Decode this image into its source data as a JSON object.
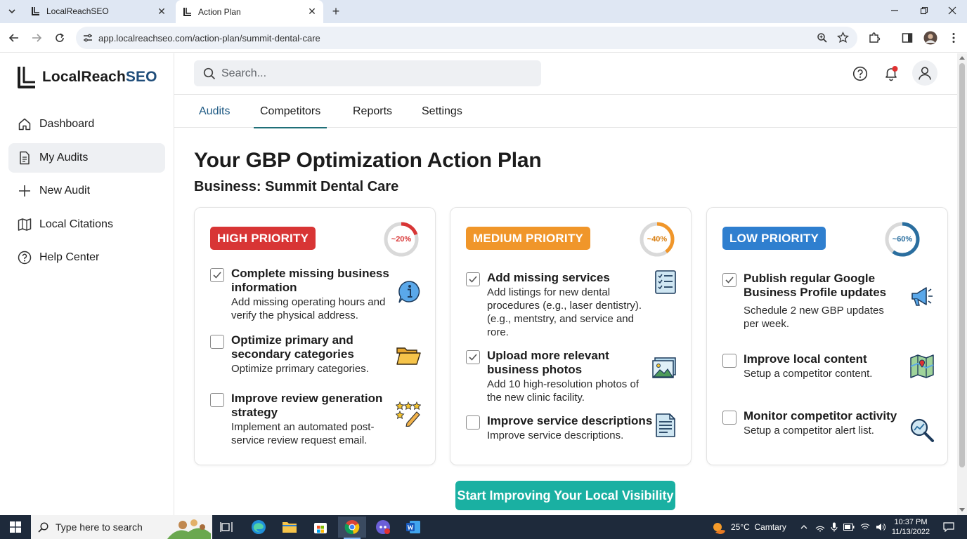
{
  "browser": {
    "tabs": [
      {
        "title": "LocalReachSEO"
      },
      {
        "title": "Action Plan"
      }
    ],
    "url": "app.localreachseo.com/action-plan/summit-dental-care"
  },
  "app": {
    "logo_main": "LocalReach",
    "logo_accent": "SEO",
    "brand_color": "#1f4d7a",
    "sidebar": [
      {
        "label": "Dashboard",
        "icon": "home-icon"
      },
      {
        "label": "My Audits",
        "icon": "document-icon",
        "active": true
      },
      {
        "label": "New Audit",
        "icon": "plus-icon"
      },
      {
        "label": "Local Citations",
        "icon": "map-icon"
      },
      {
        "label": "Help Center",
        "icon": "help-icon"
      }
    ],
    "search_placeholder": "Search...",
    "nav_tabs": [
      {
        "label": "Audits"
      },
      {
        "label": "Competitors"
      },
      {
        "label": "Reports"
      },
      {
        "label": "Settings"
      }
    ]
  },
  "page": {
    "title": "Your GBP Optimization Action Plan",
    "business": "Business: Summit Dental Care",
    "cta": "Start Improving Your Local Visibility",
    "cta_color": "#1ab0a2",
    "cards": [
      {
        "priority": "HIGH PRIORITY",
        "color": "#d83535",
        "progress_label": "~20%",
        "progress": 0.2,
        "items": [
          {
            "title": "Complete missing business information",
            "desc": "Add missing operating hours and verify the physical address.",
            "checked": true,
            "icon": "info-icon"
          },
          {
            "title": "Optimize primary and secondary categories",
            "desc": "Optimize prrimary categories.",
            "checked": false,
            "icon": "folder-icon"
          },
          {
            "title": "Improve review generation strategy",
            "desc": "Implement an automated post-service review request email.",
            "checked": false,
            "icon": "stars-pencil-icon"
          }
        ]
      },
      {
        "priority": "MEDIUM PRIORITY",
        "color": "#f0962a",
        "progress_label": "~40%",
        "progress": 0.4,
        "items": [
          {
            "title": "Add missing services",
            "desc": "Add listings for new dental procedures (e.g., laser dentistry). (e.g., mentstry, and service and rore.",
            "checked": true,
            "icon": "checklist-icon"
          },
          {
            "title": "Upload more relevant business photos",
            "desc": "Add 10 high-resolution photos of the new clinic facility.",
            "checked": true,
            "icon": "photo-icon"
          },
          {
            "title": "Improve service descriptions",
            "desc": "Improve service descriptions.",
            "checked": false,
            "icon": "document-lines-icon"
          }
        ]
      },
      {
        "priority": "LOW PRIORITY",
        "color": "#2f7fcf",
        "progress_label": "~60%",
        "progress": 0.6,
        "items": [
          {
            "title": "Publish regular Google Business Profile updates",
            "desc": "Schedule 2 new GBP updates per week.",
            "checked": true,
            "icon": "megaphone-icon"
          },
          {
            "title": "Improve local content",
            "desc": "Setup a competitor content.",
            "checked": false,
            "icon": "map-icon"
          },
          {
            "title": "Monitor competitor activity",
            "desc": "Setup a competitor alert list.",
            "checked": false,
            "icon": "magnifier-chart-icon"
          }
        ]
      }
    ]
  },
  "taskbar": {
    "search_placeholder": "Type here to search",
    "weather": "25°C  Camtary",
    "time": "10:37 PM",
    "date": "11/13/2022"
  }
}
